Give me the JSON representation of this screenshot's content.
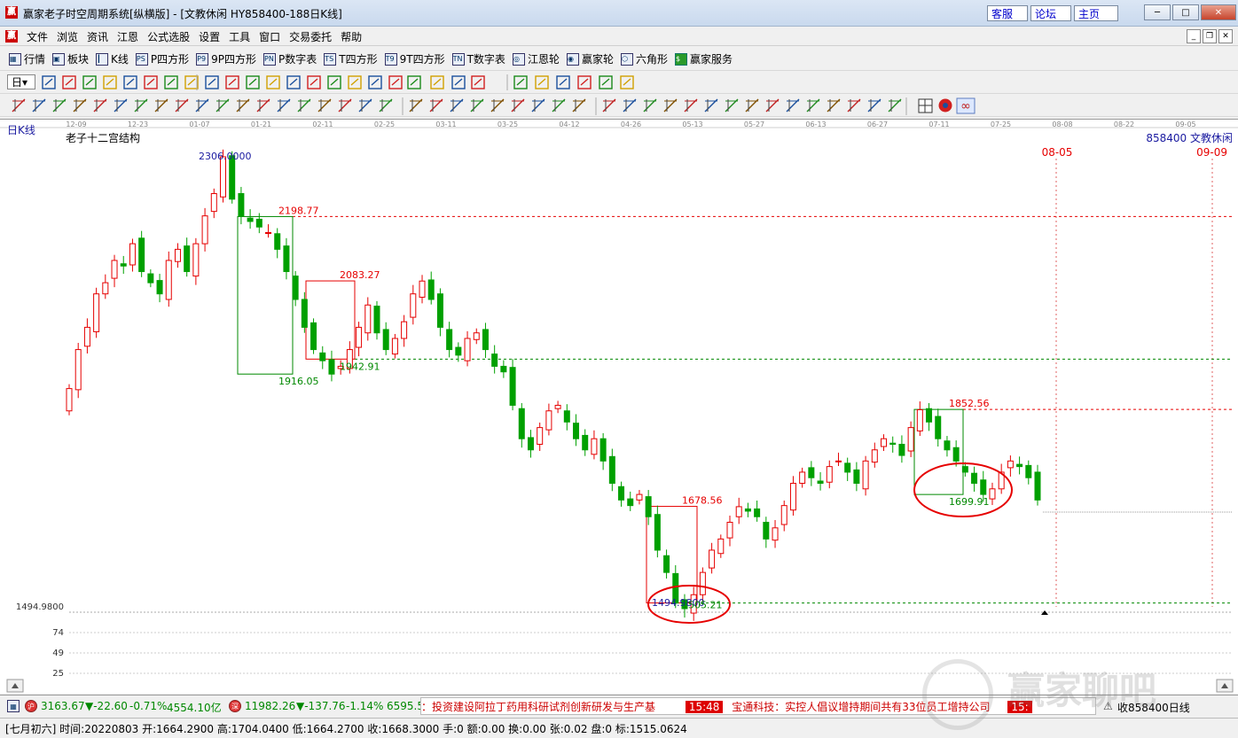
{
  "window": {
    "title": "赢家老子时空周期系统[纵横版] - [文教休闲  HY858400-188日K线]",
    "logo_char": "赢",
    "links": [
      "客服",
      "论坛",
      "主页"
    ]
  },
  "menu": {
    "items": [
      "文件",
      "浏览",
      "资讯",
      "江恩",
      "公式选股",
      "设置",
      "工具",
      "窗口",
      "交易委托",
      "帮助"
    ]
  },
  "toolbar": {
    "items": [
      {
        "icon": "grid-icon",
        "glyph": "▦",
        "label": "行情"
      },
      {
        "icon": "blocks-icon",
        "glyph": "▣",
        "label": "板块"
      },
      {
        "icon": "candle-icon",
        "glyph": "┃",
        "label": "K线"
      },
      {
        "icon": "ps-icon",
        "glyph": "PS",
        "label": "P四方形"
      },
      {
        "icon": "p9-icon",
        "glyph": "P9",
        "label": "9P四方形"
      },
      {
        "icon": "pn-icon",
        "glyph": "PN",
        "label": "P数字表"
      },
      {
        "icon": "ts-icon",
        "glyph": "TS",
        "label": "T四方形"
      },
      {
        "icon": "t9-icon",
        "glyph": "T9",
        "label": "9T四方形"
      },
      {
        "icon": "tn-icon",
        "glyph": "TN",
        "label": "T数字表"
      },
      {
        "icon": "gann-wheel-icon",
        "glyph": "◎",
        "label": "江恩轮"
      },
      {
        "icon": "winner-wheel-icon",
        "glyph": "◉",
        "label": "赢家轮"
      },
      {
        "icon": "hexagon-icon",
        "glyph": "⬡",
        "label": "六角形"
      },
      {
        "icon": "dollar-icon",
        "glyph": "$",
        "label": "赢家服务"
      }
    ]
  },
  "period_selector": "日",
  "chart": {
    "mode_label": "日K线",
    "structure_label": "老子十二宫结构",
    "symbol_label": "858400 文教休闲",
    "right_date_marker": "09-09",
    "mid_date_marker": "08-05",
    "date_ticks": [
      "12-09",
      "12-23",
      "01-07",
      "01-21",
      "02-11",
      "02-25",
      "03-11",
      "03-25",
      "04-12",
      "04-26",
      "05-13",
      "05-27",
      "06-13",
      "06-27",
      "07-11",
      "07-25",
      "08-08",
      "08-22",
      "09-05"
    ],
    "axis_labels": [
      "1494.9800",
      "74",
      "49",
      "25"
    ],
    "annotations": {
      "high": "2306.0000",
      "a": "2198.77",
      "b": "2083.27",
      "c": "1942.91",
      "d": "1916.05",
      "e": "1678.56",
      "f": "1494.9800",
      "g": "1505.21",
      "h": "1852.56",
      "i": "1699.91"
    },
    "colors": {
      "up": "#e60000",
      "down": "#00a000",
      "red_line": "#e60000",
      "green_line": "#008800",
      "ellipse": "#e60000"
    }
  },
  "chart_data": {
    "type": "candlestick",
    "title": "老子十二宫结构",
    "xlabel": "",
    "ylabel": "",
    "x_ticks": [
      "12-09",
      "12-23",
      "01-07",
      "01-21",
      "02-11",
      "02-25",
      "03-11",
      "03-25",
      "04-12",
      "04-26",
      "05-13",
      "05-27",
      "06-13",
      "06-27",
      "07-11",
      "07-25",
      "08-08",
      "08-22",
      "09-05"
    ],
    "ylim": [
      1494.98,
      2306.0
    ],
    "reference_levels": [
      2306.0,
      2198.77,
      2083.27,
      1942.91,
      1916.05,
      1852.56,
      1699.91,
      1678.56,
      1505.21,
      1494.98
    ],
    "close_series": [
      1890,
      1960,
      2000,
      2060,
      2080,
      2120,
      2110,
      2150,
      2100,
      2080,
      2060,
      2120,
      2140,
      2100,
      2150,
      2200,
      2240,
      2306,
      2230,
      2200,
      2190,
      2180,
      2170,
      2140,
      2100,
      2050,
      2000,
      1960,
      1940,
      1916,
      1930,
      1960,
      2000,
      2040,
      1990,
      1960,
      1980,
      2010,
      2060,
      2083,
      2050,
      2000,
      1960,
      1950,
      1980,
      1990,
      1960,
      1930,
      1920,
      1860,
      1800,
      1780,
      1820,
      1850,
      1860,
      1830,
      1800,
      1780,
      1800,
      1760,
      1720,
      1690,
      1680,
      1700,
      1660,
      1600,
      1560,
      1505,
      1495,
      1520,
      1560,
      1600,
      1620,
      1650,
      1678,
      1670,
      1660,
      1620,
      1640,
      1680,
      1720,
      1740,
      1730,
      1720,
      1750,
      1760,
      1740,
      1720,
      1760,
      1780,
      1800,
      1790,
      1770,
      1820,
      1852,
      1830,
      1800,
      1780,
      1760,
      1740,
      1720,
      1700,
      1710,
      1740,
      1760,
      1750,
      1730,
      1690
    ]
  },
  "ticker": {
    "idx1_value": "3163.67",
    "idx1_change": "▼-22.60",
    "idx1_pct": "-0.71%",
    "idx1_amount": "4554.10亿",
    "idx2_value": "11982.26",
    "idx2_change": "▼-137.76",
    "idx2_pct": "-1.14%",
    "idx2_amount": "6595.5",
    "news1": "：投资建设阿拉丁药用科研试剂创新研发与生产基",
    "time1": "15:48",
    "news2": "宝通科技：实控人倡议增持期间共有33位员工增持公司",
    "time2": "15:",
    "right_label": "收858400日线"
  },
  "status": {
    "text": "[七月初六] 时间:20220803 开:1664.2900 高:1704.0400 低:1664.2700 收:1668.3000 手:0 额:0.00 换:0.00 张:0.02 盘:0 标:1515.0624"
  },
  "watermark": "赢家聊吧"
}
